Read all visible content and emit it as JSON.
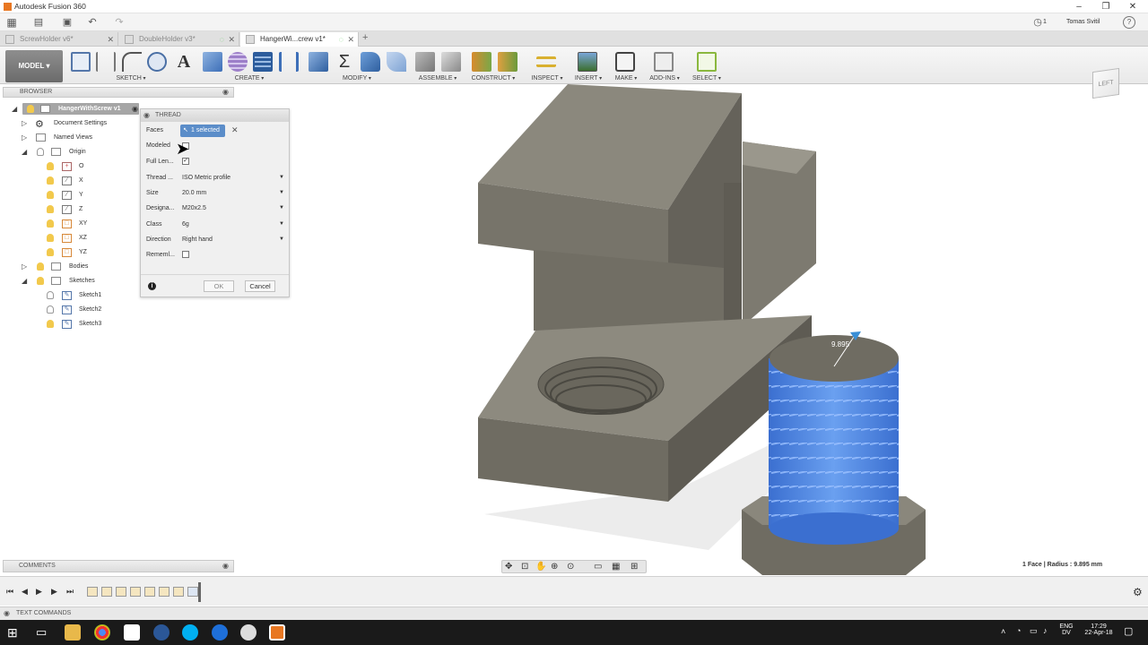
{
  "titlebar": {
    "title": "Autodesk Fusion 360"
  },
  "qat": {
    "job_count": "1",
    "user": "Tomas Svitil",
    "help": "?"
  },
  "tabs": [
    {
      "label": "ScrewHolder v6*"
    },
    {
      "label": "DoubleHolder v3*"
    },
    {
      "label": "HangerWi...crew v1*"
    }
  ],
  "ribbon": {
    "workspace": "MODEL",
    "groups": [
      "SKETCH",
      "CREATE",
      "MODIFY",
      "ASSEMBLE",
      "CONSTRUCT",
      "INSPECT",
      "INSERT",
      "MAKE",
      "ADD-INS",
      "SELECT"
    ]
  },
  "viewcube": {
    "face": "LEFT"
  },
  "browser": {
    "header": "BROWSER",
    "root": "HangerWithScrew v1",
    "doc_settings": "Document Settings",
    "named_views": "Named Views",
    "origin": "Origin",
    "origin_items": [
      "O",
      "X",
      "Y",
      "Z",
      "XY",
      "XZ",
      "YZ"
    ],
    "bodies": "Bodies",
    "sketches": "Sketches",
    "sketch_items": [
      "Sketch1",
      "Sketch2",
      "Sketch3"
    ]
  },
  "thread_dialog": {
    "title": "THREAD",
    "faces_label": "Faces",
    "faces_value": "1 selected",
    "modeled_label": "Modeled",
    "full_length_label": "Full Len...",
    "full_length_checked": true,
    "thread_type_label": "Thread ...",
    "thread_type_value": "ISO Metric profile",
    "size_label": "Size",
    "size_value": "20.0 mm",
    "designation_label": "Designa...",
    "designation_value": "M20x2.5",
    "class_label": "Class",
    "class_value": "6g",
    "direction_label": "Direction",
    "direction_value": "Right hand",
    "remember_label": "Rememl...",
    "ok_label": "OK",
    "cancel_label": "Cancel"
  },
  "viewport": {
    "dimension_label": "9.895",
    "status_text": "1 Face | Radius : 9.895 mm"
  },
  "comments": {
    "header": "COMMENTS"
  },
  "textcmd": {
    "label": "TEXT COMMANDS"
  },
  "taskbar": {
    "lang": "ENG",
    "sub_lang": "DV",
    "time": "17:29",
    "date": "22-Apr-18"
  },
  "colors": {
    "accent": "#5b8dc9",
    "thread_blue": "#4a86e8",
    "model_gray": "#6f6c62"
  }
}
